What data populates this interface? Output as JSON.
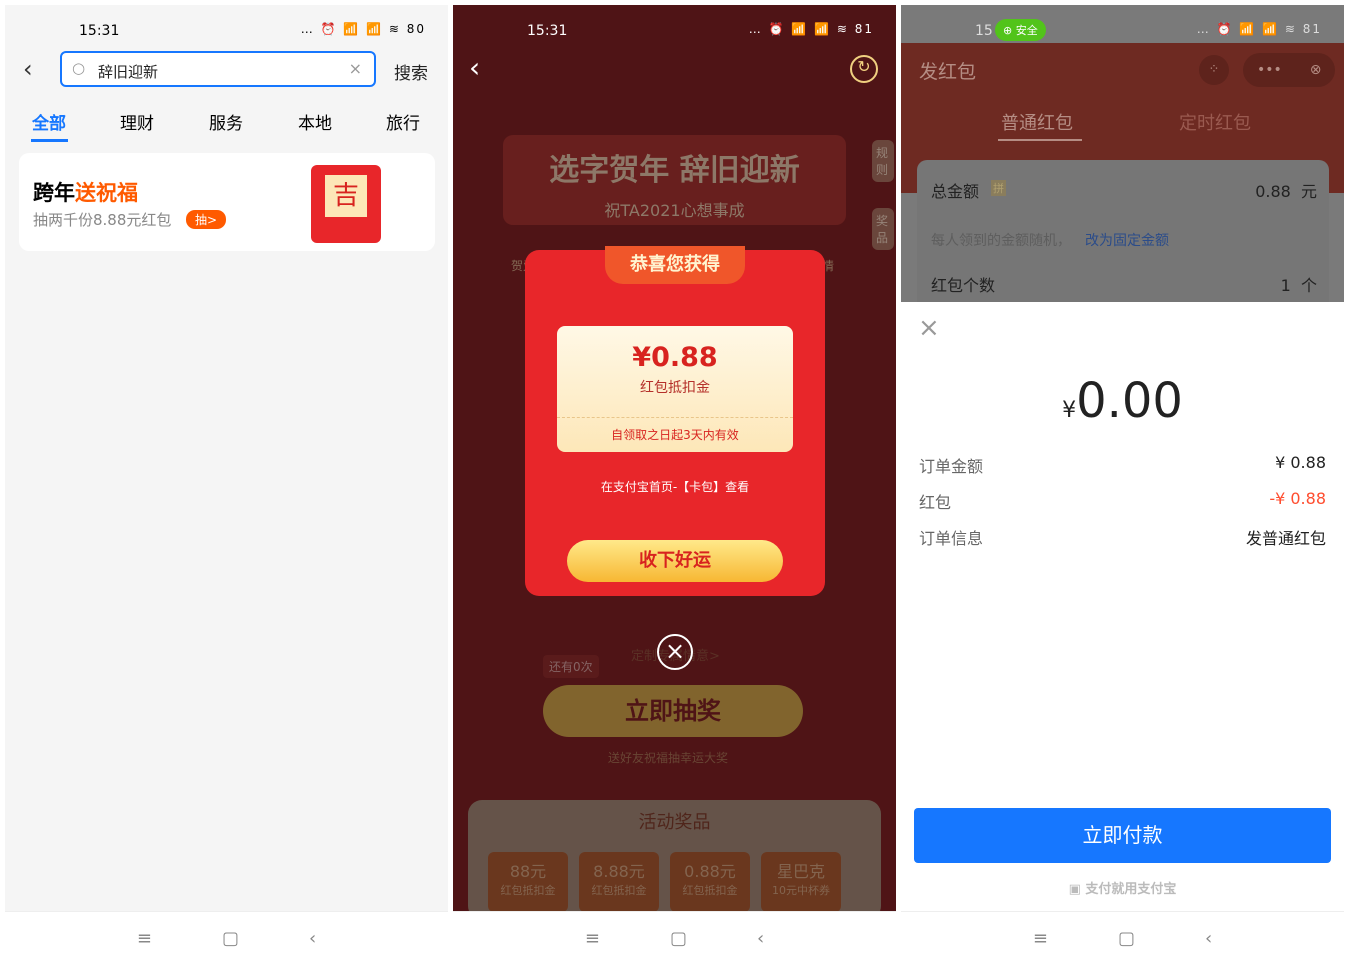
{
  "panel1": {
    "time": "15:31",
    "status_icons": "… ⏰ 📶 📶 ≋ 80",
    "search_value": "辞旧迎新",
    "search_button": "搜索",
    "tabs": [
      "全部",
      "理财",
      "服务",
      "本地",
      "旅行"
    ],
    "card": {
      "title_a": "跨年",
      "title_b": "送祝福",
      "subtitle": "抽两千份8.88元红包",
      "badge": "抽>",
      "image_char": "吉"
    }
  },
  "panel2": {
    "time": "15:31",
    "status_icons": "… ⏰ 📶 📶 ≋ 81",
    "banner_title": "选字贺年 辞旧迎新",
    "banner_sub": "祝TA2021心想事成",
    "side_rules": "规则",
    "side_prizes": "奖品",
    "card_label": "贺爱情",
    "modal": {
      "header": "恭喜您获得",
      "amount": "¥0.88",
      "amount_label": "红包抵扣金",
      "validity": "自领取之日起3天内有效",
      "hint": "在支付宝首页-【卡包】查看",
      "button": "收下好运"
    },
    "remaining": "还有0次",
    "custom_link": "定制专属情意>",
    "draw_button": "立即抽奖",
    "draw_sub": "送好友祝福抽幸运大奖",
    "prizes_title": "活动奖品",
    "prizes": [
      {
        "v": "88元",
        "l": "红包抵扣金"
      },
      {
        "v": "8.88元",
        "l": "红包抵扣金"
      },
      {
        "v": "0.88元",
        "l": "红包抵扣金"
      },
      {
        "v": "星巴克",
        "l": "10元中杯券"
      }
    ]
  },
  "panel3": {
    "time": "15",
    "safe_badge": "安全",
    "status_icons": "… ⏰ 📶 📶 ≋ 81",
    "title": "发红包",
    "tabs": [
      "普通红包",
      "定时红包"
    ],
    "total_label": "总金额",
    "pin": "拼",
    "total_value": "0.88",
    "total_unit": "元",
    "random_hint": "每人领到的金额随机，",
    "fixed_link": "改为固定金额",
    "count_label": "红包个数",
    "count_value": "1",
    "count_unit": "个",
    "currency": "¥",
    "amount": "0.00",
    "rows": [
      {
        "k": "订单金额",
        "v": "¥ 0.88"
      },
      {
        "k": "红包",
        "v": "-¥ 0.88"
      },
      {
        "k": "订单信息",
        "v": "发普通红包"
      }
    ],
    "pay_button": "立即付款",
    "footer": "支付就用支付宝"
  },
  "colors": {
    "blue": "#1677ff",
    "red": "#e8262a",
    "orange": "#ff5a00"
  }
}
